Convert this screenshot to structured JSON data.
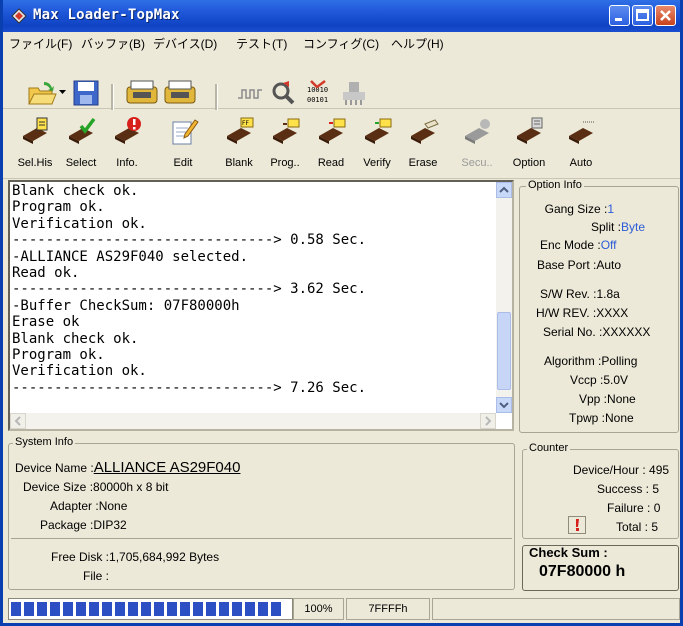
{
  "window": {
    "title": "Max Loader-TopMax"
  },
  "menu": [
    "ファイル(F)",
    "バッファ(B)",
    "デバイス(D)",
    "テスト(T)",
    "コンフィグ(C)",
    "ヘルプ(H)"
  ],
  "toolbar2": [
    {
      "label": "Sel.His",
      "icon": "chip-history-icon"
    },
    {
      "label": "Select",
      "icon": "chip-select-icon"
    },
    {
      "label": "Info.",
      "icon": "chip-info-icon"
    },
    {
      "label": "Edit",
      "icon": "edit-icon"
    },
    {
      "label": "Blank",
      "icon": "chip-blank-icon"
    },
    {
      "label": "Prog..",
      "icon": "chip-program-icon"
    },
    {
      "label": "Read",
      "icon": "chip-read-icon"
    },
    {
      "label": "Verify",
      "icon": "chip-verify-icon"
    },
    {
      "label": "Erase",
      "icon": "chip-erase-icon"
    },
    {
      "label": "Secu..",
      "icon": "chip-security-icon"
    },
    {
      "label": "Option",
      "icon": "chip-option-icon"
    },
    {
      "label": "Auto",
      "icon": "chip-auto-icon"
    }
  ],
  "log": {
    "lines": [
      "Blank check ok.",
      "Program ok.",
      "Verification ok.",
      "-------------------------------> 0.58 Sec.",
      "-ALLIANCE AS29F040 selected.",
      "Read ok.",
      "-------------------------------> 3.62 Sec.",
      "-Buffer CheckSum: 07F80000h",
      "Erase ok",
      "Blank check ok.",
      "Program ok.",
      "Verification ok.",
      "-------------------------------> 7.26 Sec."
    ]
  },
  "option_info": {
    "title": "Option Info",
    "gang_size_label": "Gang Size :",
    "gang_size": "1",
    "split_label": "Split :",
    "split": "Byte",
    "enc_mode_label": "Enc Mode :",
    "enc_mode": "Off",
    "base_port_label": "Base Port :",
    "base_port": "Auto",
    "sw_rev_label": "S/W Rev. :",
    "sw_rev": "1.8a",
    "hw_rev_label": "H/W REV. :",
    "hw_rev": "XXXX",
    "serial_label": "Serial No. :",
    "serial": "XXXXXX",
    "algorithm_label": "Algorithm :",
    "algorithm": "Polling",
    "vccp_label": "Vccp :",
    "vccp": "5.0V",
    "vpp_label": "Vpp :",
    "vpp": "None",
    "tpwp_label": "Tpwp :",
    "tpwp": "None"
  },
  "system_info": {
    "title": "System Info",
    "device_name_label": "Device Name :",
    "device_name": "ALLIANCE AS29F040",
    "device_size_label": "Device Size :",
    "device_size": "80000h x 8 bit",
    "adapter_label": "Adapter :",
    "adapter": "None",
    "package_label": "Package :",
    "package": "DIP32",
    "free_disk_label": "Free Disk :",
    "free_disk": "1,705,684,992 Bytes",
    "file_label": "File :",
    "file": ""
  },
  "counter": {
    "title": "Counter",
    "device_hour_label": "Device/Hour :",
    "device_hour": "495",
    "success_label": "Success :",
    "success": "5",
    "failure_label": "Failure :",
    "failure": "0",
    "total_label": "Total :",
    "total": "5"
  },
  "checksum": {
    "label": "Check Sum :",
    "value": "07F80000 h"
  },
  "status": {
    "progress_text": "100%",
    "progress_fraction": 1.0,
    "address": "7FFFFh"
  },
  "colors": {
    "title_bar": "#1e56d8",
    "accent_blue": "#2b5bd7",
    "progress_fill": "#2d4fc4"
  }
}
